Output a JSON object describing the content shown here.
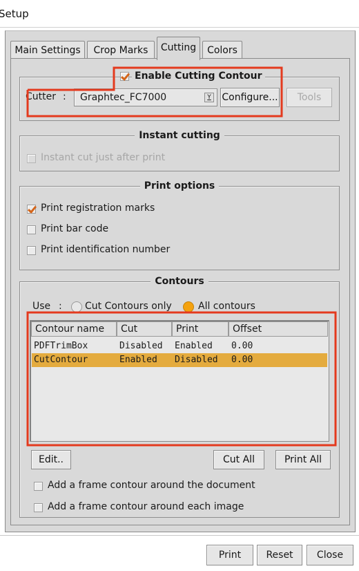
{
  "window": {
    "title": "Setup"
  },
  "tabs": [
    {
      "label": "Main Settings",
      "active": false
    },
    {
      "label": "Crop Marks",
      "active": false
    },
    {
      "label": "Cutting",
      "active": true
    },
    {
      "label": "Colors",
      "active": false
    }
  ],
  "cutting_contour": {
    "enable_label": "Enable Cutting Contour",
    "enabled": true,
    "cutter_label": "Cutter",
    "cutter_separator": ":",
    "cutter_value": "Graphtec_FC7000",
    "dropdown_glyph": "Y",
    "configure_label": "Configure...",
    "tools_label": "Tools"
  },
  "instant_cutting": {
    "title": "Instant cutting",
    "option_label": "Instant cut just after print",
    "checked": false,
    "disabled": true
  },
  "print_options": {
    "title": "Print options",
    "items": [
      {
        "label": "Print registration marks",
        "checked": true
      },
      {
        "label": "Print bar code",
        "checked": false
      },
      {
        "label": "Print identification number",
        "checked": false
      }
    ]
  },
  "contours": {
    "title": "Contours",
    "use_label": "Use",
    "use_separator": ":",
    "radio_cut_only": "Cut Contours only",
    "radio_all": "All contours",
    "selected_radio": "all",
    "columns": [
      "Contour name",
      "Cut",
      "Print",
      "Offset"
    ],
    "rows": [
      {
        "name": "PDFTrimBox",
        "cut": "Disabled",
        "print": "Enabled",
        "offset": "0.00",
        "selected": false
      },
      {
        "name": "CutContour",
        "cut": "Enabled",
        "print": "Disabled",
        "offset": "0.00",
        "selected": true
      }
    ],
    "edit_label": "Edit..",
    "cut_all_label": "Cut All",
    "print_all_label": "Print All",
    "frame_options": [
      {
        "label": "Add a frame contour around the document",
        "checked": false
      },
      {
        "label": "Add a frame contour around each image",
        "checked": false
      }
    ]
  },
  "footer": {
    "print_label": "Print",
    "reset_label": "Reset",
    "close_label": "Close"
  },
  "colors": {
    "accent": "#f4a20f",
    "selection": "#e4ab3e",
    "annotation": "#e43a1e",
    "panel": "#d9d9d9"
  }
}
